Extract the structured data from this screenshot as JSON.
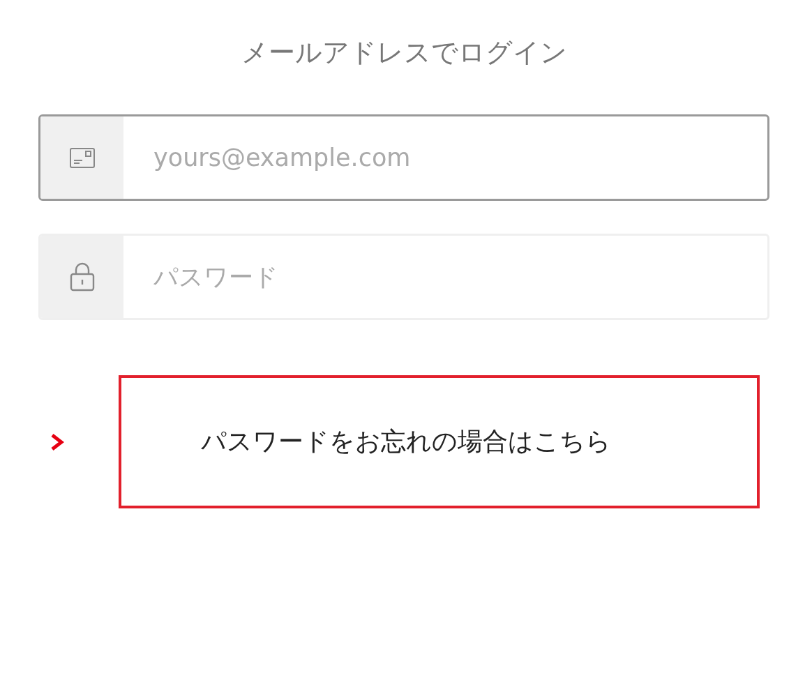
{
  "title": "メールアドレスでログイン",
  "fields": [
    {
      "kind": "email",
      "placeholder": "yours@example.com",
      "focused": true
    },
    {
      "kind": "password",
      "placeholder": "パスワード",
      "focused": false
    }
  ],
  "forgot_link": {
    "text": "パスワードをお忘れの場合はこちら",
    "highlighted": true
  }
}
